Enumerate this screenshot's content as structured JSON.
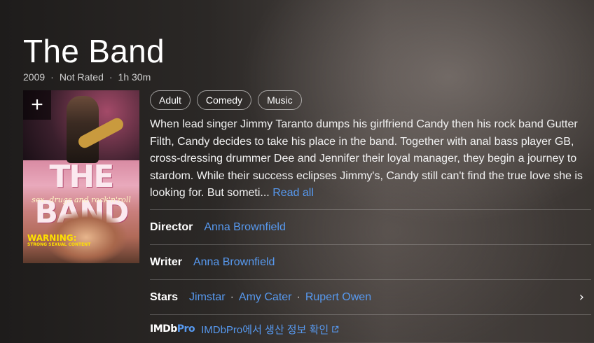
{
  "title": "The Band",
  "meta": {
    "year": "2009",
    "rating": "Not Rated",
    "runtime": "1h 30m"
  },
  "poster": {
    "title_text": "THE BAND",
    "tagline": "sex, drugs and rock'n'roll",
    "warning": "WARNING:",
    "warning_sub": "STRONG SEXUAL CONTENT",
    "add_label": "+"
  },
  "genres": [
    "Adult",
    "Comedy",
    "Music"
  ],
  "plot": {
    "text": "When lead singer Jimmy Taranto dumps his girlfriend Candy then his rock band Gutter Filth, Candy decides to take his place in the band. Together with anal bass player GB, cross-dressing drummer Dee and Jennifer their loyal manager, they begin a journey to stardom. While their success eclipses Jimmy's, Candy still can't find the true love she is looking for. But someti...",
    "read_all": "Read all"
  },
  "credits": {
    "director": {
      "label": "Director",
      "names": [
        "Anna Brownfield"
      ]
    },
    "writer": {
      "label": "Writer",
      "names": [
        "Anna Brownfield"
      ]
    },
    "stars": {
      "label": "Stars",
      "names": [
        "Jimstar",
        "Amy Cater",
        "Rupert Owen"
      ],
      "chevron": "›"
    }
  },
  "imdbpro": {
    "logo_imdb": "IMDb",
    "logo_pro": "Pro",
    "link": "IMDbPro에서 생산 정보 확인"
  },
  "colors": {
    "link": "#5799ef",
    "text": "#ffffff",
    "muted": "#cfcfcf"
  }
}
